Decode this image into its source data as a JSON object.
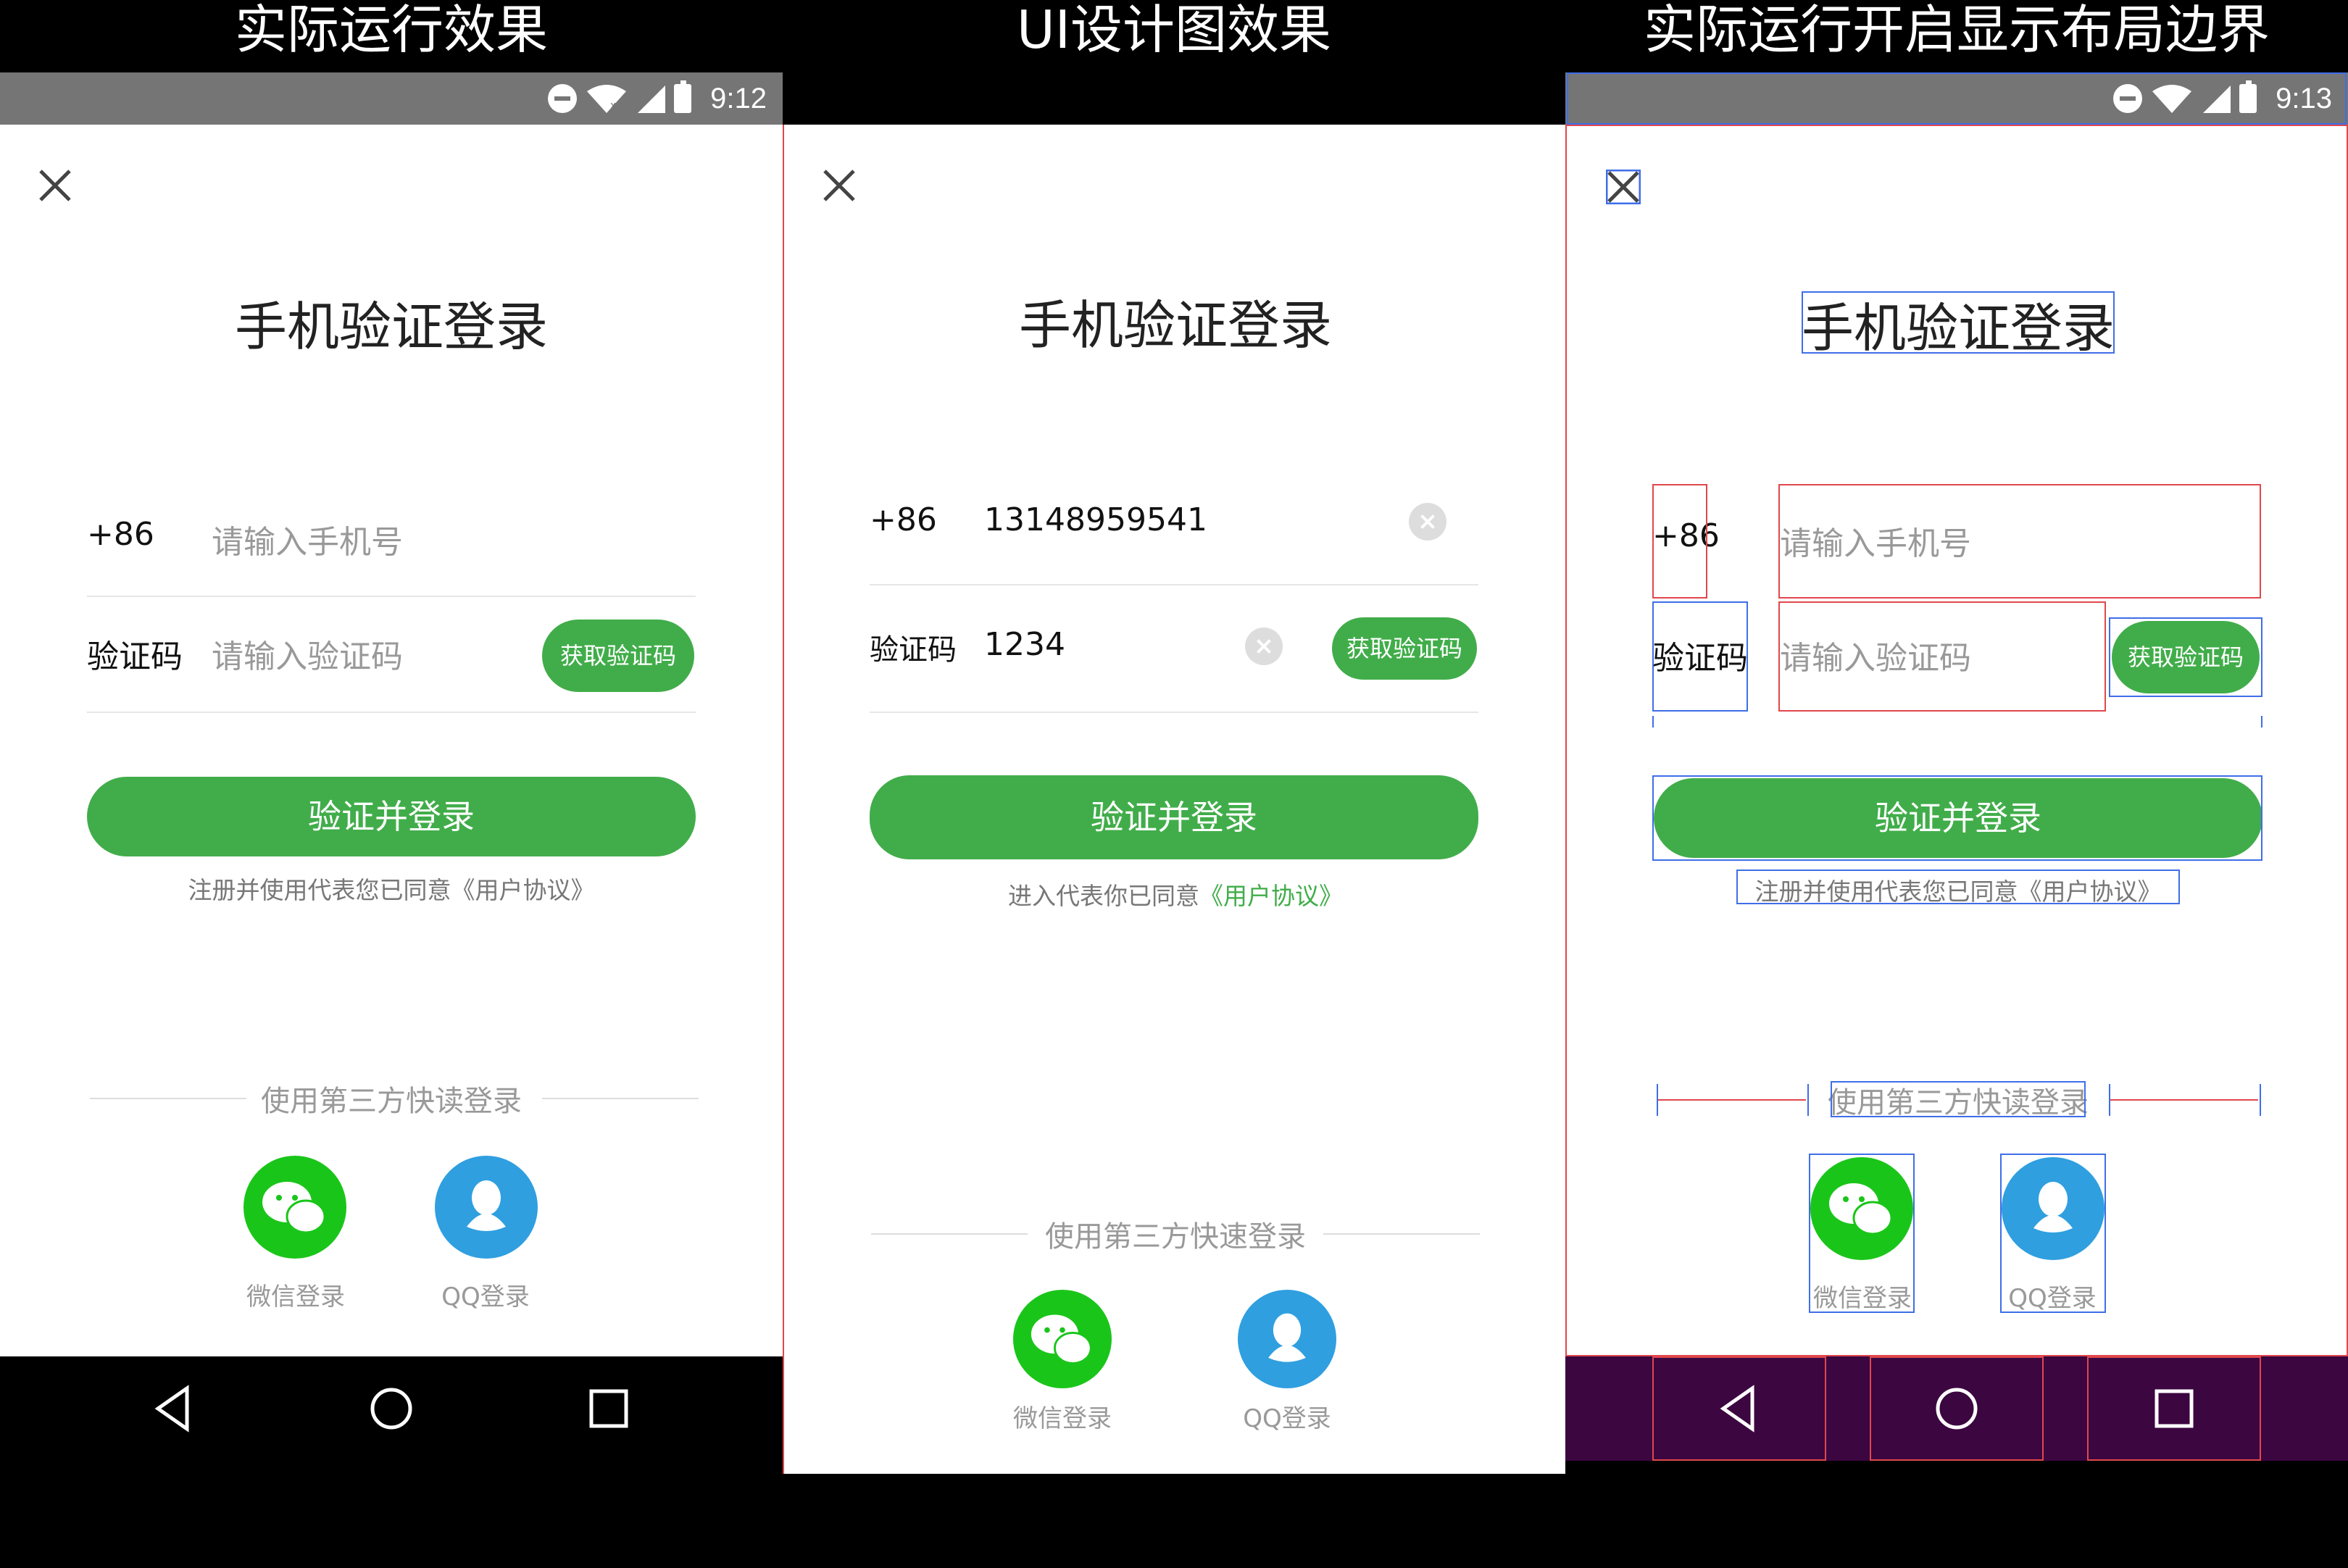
{
  "captions": {
    "left": "实际运行效果",
    "middle": "UI设计图效果",
    "right": "实际运行开启显示布局边界"
  },
  "status_bar": {
    "time_left": "9:12",
    "time_right": "9:13",
    "icons": [
      "do-not-disturb-icon",
      "wifi-icon",
      "signal-icon",
      "battery-charging-icon"
    ]
  },
  "login": {
    "title": "手机验证登录",
    "country_code": "+86",
    "phone_placeholder": "请输入手机号",
    "code_label": "验证码",
    "code_placeholder": "请输入验证码",
    "get_code_button": "获取验证码",
    "submit_button": "验证并登录",
    "agreement_runtime": "注册并使用代表您已同意《用户协议》",
    "agreement_design_prefix": "进入代表你已同意",
    "agreement_design_link": "《用户协议》",
    "third_party_runtime": "使用第三方快读登录",
    "third_party_design": "使用第三方快速登录",
    "wechat_label": "微信登录",
    "qq_label": "QQ登录"
  },
  "design": {
    "phone_value": "13148959541",
    "code_value": "1234"
  },
  "colors": {
    "accent_green": "#41ad4a",
    "wechat_green": "#1ac51a",
    "qq_blue": "#2f9fe0",
    "link_green": "#41ad4a"
  }
}
